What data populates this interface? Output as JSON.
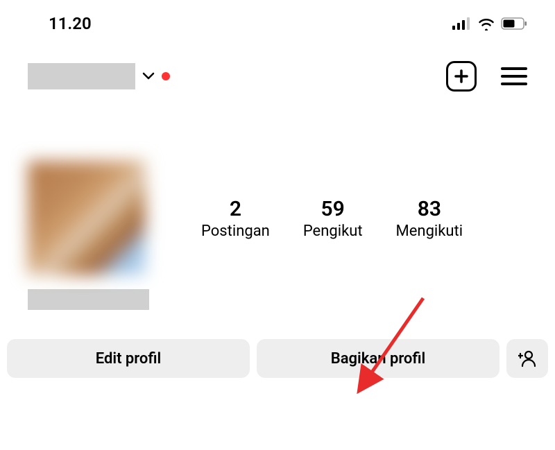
{
  "status": {
    "time": "11.20"
  },
  "header": {
    "username_redacted": true
  },
  "stats": {
    "posts": {
      "count": "2",
      "label": "Postingan"
    },
    "followers": {
      "count": "59",
      "label": "Pengikut"
    },
    "following": {
      "count": "83",
      "label": "Mengikuti"
    }
  },
  "buttons": {
    "edit": "Edit profil",
    "share": "Bagikan profil"
  }
}
